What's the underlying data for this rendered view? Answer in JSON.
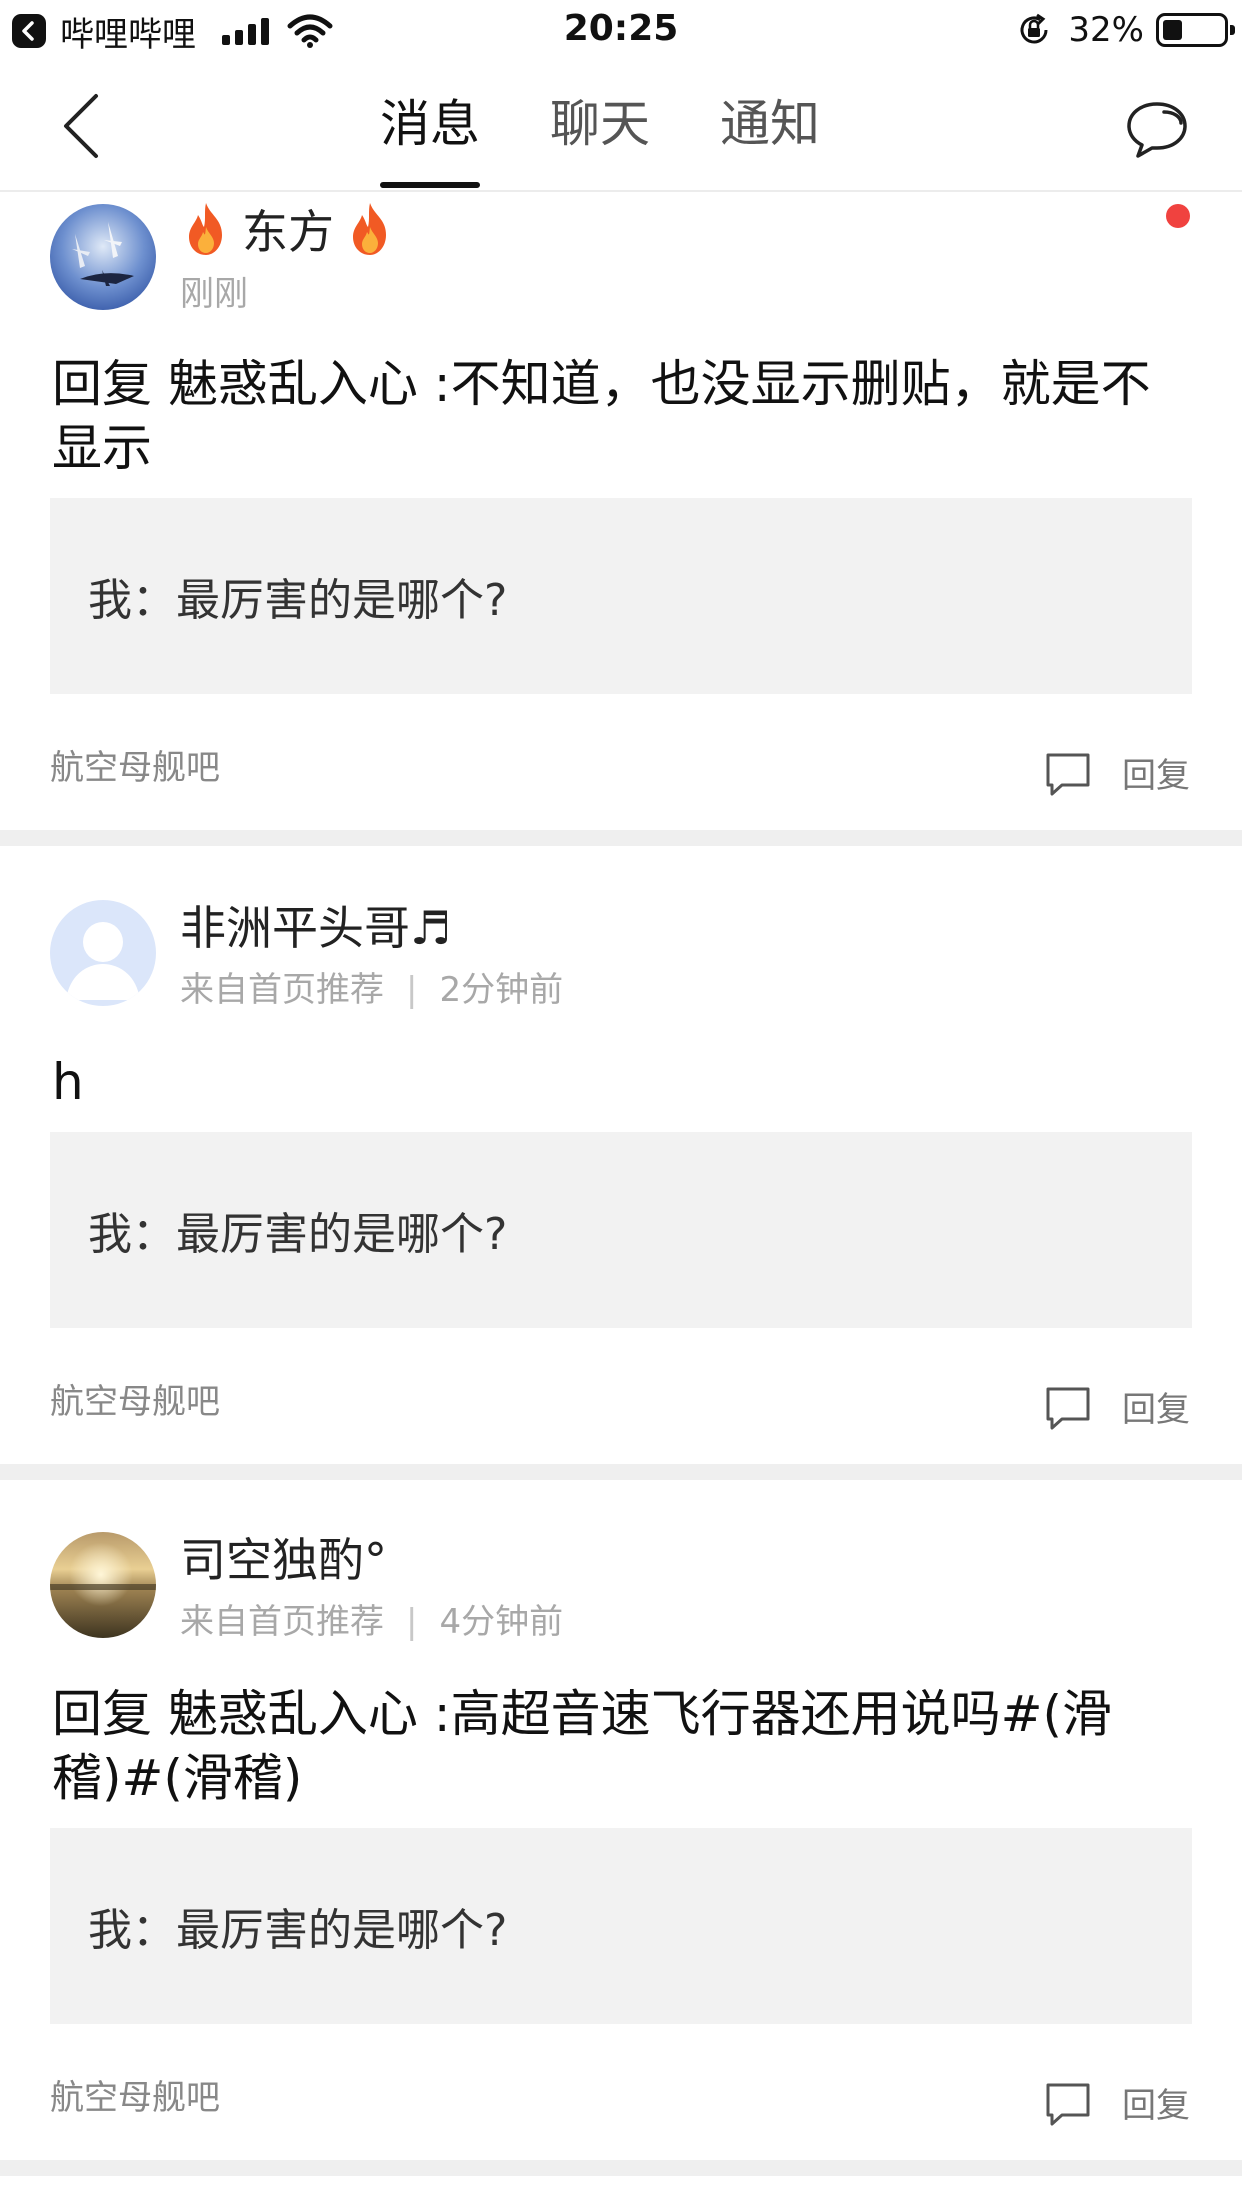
{
  "status_bar": {
    "app_name": "哔哩哔哩",
    "time": "20:25",
    "battery_text": "32%",
    "battery_level": 0.32
  },
  "nav": {
    "tabs": [
      {
        "label": "消息",
        "active": true
      },
      {
        "label": "聊天",
        "active": false
      },
      {
        "label": "通知",
        "active": false
      }
    ]
  },
  "messages": [
    {
      "author": "东方",
      "meta_source": "",
      "meta_time": "刚刚",
      "content": "回复 魅惑乱入心 :不知道，也没显示删贴，就是不显示",
      "quote": "我：最厉害的是哪个?",
      "forum": "航空母舰吧",
      "reply_label": "回复",
      "unread": true
    },
    {
      "author": "非洲平头哥♬",
      "meta_source": "来自首页推荐",
      "meta_separator": "|",
      "meta_time": "2分钟前",
      "content": "h",
      "quote": "我：最厉害的是哪个?",
      "forum": "航空母舰吧",
      "reply_label": "回复"
    },
    {
      "author": "司空独酌°",
      "meta_source": "来自首页推荐",
      "meta_separator": "|",
      "meta_time": "4分钟前",
      "content": "回复 魅惑乱入心 :高超音速飞行器还用说吗#(滑稽)#(滑稽)",
      "quote": "我：最厉害的是哪个?",
      "forum": "航空母舰吧",
      "reply_label": "回复"
    }
  ],
  "colors": {
    "unread_dot": "#f0423f",
    "quote_bg": "#f2f2f2",
    "separator": "#efefef"
  }
}
